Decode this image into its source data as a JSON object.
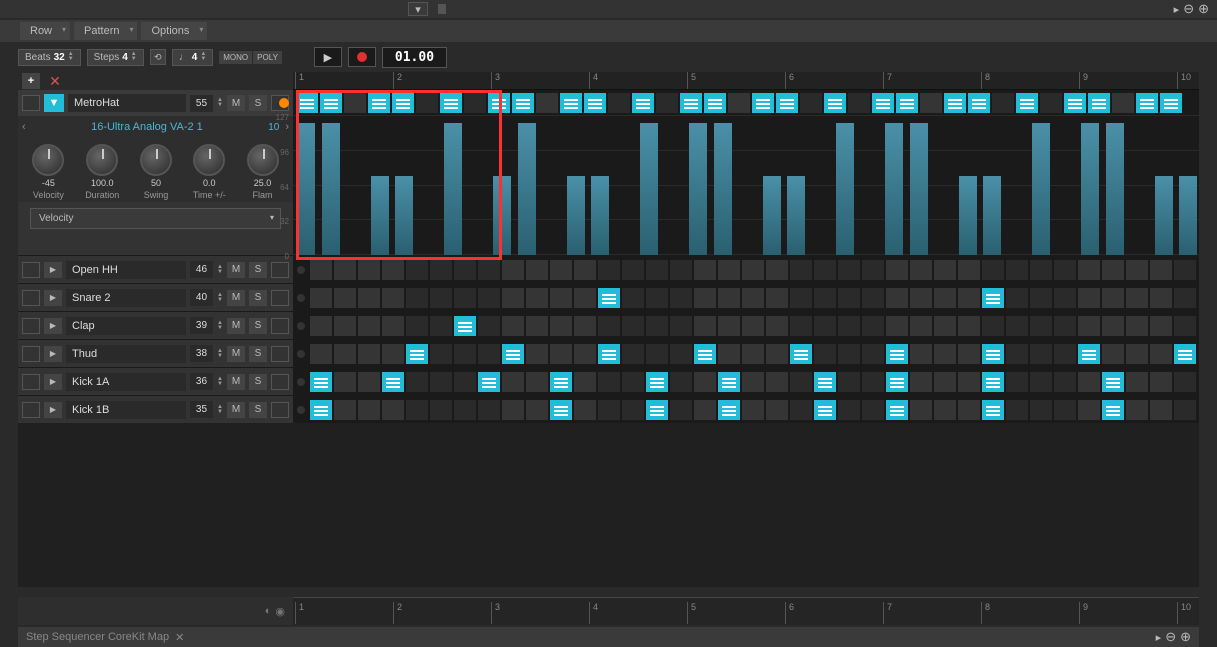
{
  "menu": {
    "row": "Row",
    "pattern": "Pattern",
    "options": "Options"
  },
  "transport": {
    "beats_label": "Beats",
    "beats_val": "32",
    "steps_label": "Steps",
    "steps_val": "4",
    "note_val": "4",
    "mono": "MONO",
    "poly": "POLY",
    "position": "01.00"
  },
  "ruler": [
    1,
    2,
    3,
    4,
    5,
    6,
    7,
    8,
    9,
    10
  ],
  "expanded": {
    "name": "MetroHat",
    "num": "55",
    "mute": "M",
    "solo": "S",
    "preset": "16-Ultra Analog VA-2 1",
    "preset_num": "10",
    "knobs": [
      {
        "val": "-45",
        "label": "Velocity"
      },
      {
        "val": "100.0",
        "label": "Duration"
      },
      {
        "val": "50",
        "label": "Swing"
      },
      {
        "val": "0.0",
        "label": "Time +/-"
      },
      {
        "val": "25.0",
        "label": "Flam"
      }
    ],
    "selector": "Velocity",
    "axis": [
      127,
      96,
      64,
      32,
      0
    ],
    "steps": [
      1,
      1,
      0,
      1,
      1,
      0,
      1,
      0,
      1,
      1,
      0,
      1,
      1,
      0,
      1,
      0,
      1,
      1,
      0,
      1,
      1,
      0,
      1,
      0,
      1,
      1,
      0,
      1,
      1,
      0,
      1,
      0,
      1,
      1,
      0,
      1,
      1
    ],
    "velocities": [
      100,
      100,
      0,
      60,
      60,
      0,
      100,
      0,
      60,
      100,
      0,
      60,
      60,
      0,
      100,
      0,
      100,
      100,
      0,
      60,
      60,
      0,
      100,
      0,
      100,
      100,
      0,
      60,
      60,
      0,
      100,
      0,
      100,
      100,
      0,
      60,
      60
    ]
  },
  "tracks": [
    {
      "name": "Open HH",
      "num": "46",
      "steps": []
    },
    {
      "name": "Snare 2",
      "num": "40",
      "steps": [
        12,
        28
      ]
    },
    {
      "name": "Clap",
      "num": "39",
      "steps": [
        6
      ]
    },
    {
      "name": "Thud",
      "num": "38",
      "steps": [
        4,
        8,
        12,
        16,
        20,
        24,
        28,
        32,
        36
      ]
    },
    {
      "name": "Kick 1A",
      "num": "36",
      "steps": [
        0,
        3,
        7,
        10,
        14,
        17,
        21,
        24,
        28,
        33
      ]
    },
    {
      "name": "Kick 1B",
      "num": "35",
      "steps": [
        0,
        10,
        14,
        17,
        21,
        24,
        28,
        33
      ]
    }
  ],
  "footer": {
    "title": "Step Sequencer CoreKit Map"
  }
}
